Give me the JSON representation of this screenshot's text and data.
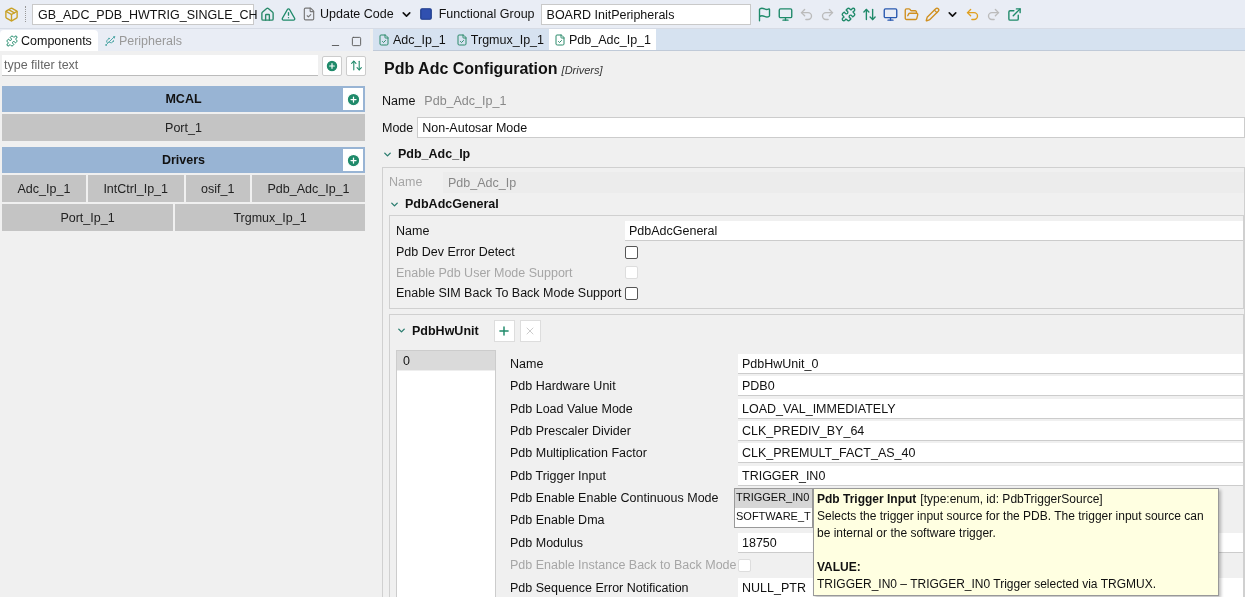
{
  "toolbar": {
    "project": "GB_ADC_PDB_HWTRIG_SINGLE_CH",
    "update_code": "Update Code",
    "functional_group_label": "Functional Group",
    "functional_group": "BOARD InitPeripherals"
  },
  "left_panel": {
    "tabs": [
      {
        "label": "Components",
        "selected": true
      },
      {
        "label": "Peripherals",
        "selected": false
      }
    ],
    "filter": {
      "placeholder": "type filter text"
    },
    "groups": [
      {
        "title": "MCAL",
        "rows": [
          [
            "Port_1"
          ]
        ]
      },
      {
        "title": "Drivers",
        "rows": [
          [
            "Adc_Ip_1",
            "IntCtrl_Ip_1",
            "osif_1",
            "Pdb_Adc_Ip_1"
          ],
          [
            "Port_Ip_1",
            "Trgmux_Ip_1"
          ]
        ]
      }
    ]
  },
  "editor_tabs": [
    {
      "label": "Adc_Ip_1",
      "selected": false
    },
    {
      "label": "Trgmux_Ip_1",
      "selected": false
    },
    {
      "label": "Pdb_Adc_Ip_1",
      "selected": true
    }
  ],
  "config": {
    "title": "Pdb Adc Configuration",
    "subtitle": "[Drivers]",
    "name": {
      "label": "Name",
      "value": "Pdb_Adc_Ip_1"
    },
    "mode": {
      "label": "Mode",
      "value": "Non-Autosar Mode"
    },
    "section": {
      "title": "Pdb_Adc_Ip",
      "expanded": true,
      "name_label": "Name",
      "name_value": "Pdb_Adc_Ip",
      "general": {
        "title": "PdbAdcGeneral",
        "expanded": true,
        "rows": [
          {
            "kind": "text",
            "label": "Name",
            "value": "PdbAdcGeneral",
            "disabled": false
          },
          {
            "kind": "checkbox",
            "label": "Pdb Dev Error Detect",
            "checked": false,
            "disabled": false
          },
          {
            "kind": "checkbox",
            "label": "Enable Pdb User Mode Support",
            "checked": false,
            "disabled": true
          },
          {
            "kind": "checkbox",
            "label": "Enable SIM Back To Back Mode Support",
            "checked": false,
            "disabled": false
          }
        ]
      },
      "hw_unit": {
        "title": "PdbHwUnit",
        "expanded": true,
        "list": [
          {
            "label": "0",
            "selected": true
          }
        ],
        "rows": [
          {
            "kind": "text",
            "label": "Name",
            "value": "PdbHwUnit_0",
            "disabled": false
          },
          {
            "kind": "text",
            "label": "Pdb Hardware Unit",
            "value": "PDB0",
            "disabled": false
          },
          {
            "kind": "text",
            "label": "Pdb Load Value Mode",
            "value": "LOAD_VAL_IMMEDIATELY",
            "disabled": false
          },
          {
            "kind": "text",
            "label": "Pdb Prescaler Divider",
            "value": "CLK_PREDIV_BY_64",
            "disabled": false
          },
          {
            "kind": "text",
            "label": "Pdb Multiplication Factor",
            "value": "CLK_PREMULT_FACT_AS_40",
            "disabled": false
          },
          {
            "kind": "text",
            "label": "Pdb Trigger Input",
            "value": "TRIGGER_IN0",
            "disabled": false
          },
          {
            "kind": "label",
            "label": "Pdb Enable Enable Continuous Mode",
            "disabled": false
          },
          {
            "kind": "label",
            "label": "Pdb Enable Dma",
            "disabled": false
          },
          {
            "kind": "text",
            "label": "Pdb Modulus",
            "value": "18750",
            "disabled": false
          },
          {
            "kind": "checkbox",
            "label": "Pdb Enable Instance Back to Back Mode",
            "checked": false,
            "disabled": true
          },
          {
            "kind": "text",
            "label": "Pdb Sequence Error Notification",
            "value": "NULL_PTR",
            "disabled": false
          }
        ]
      }
    }
  },
  "dropdown": {
    "options": [
      {
        "label": "TRIGGER_IN0",
        "selected": true
      },
      {
        "label": "SOFTWARE_T",
        "selected": false
      }
    ]
  },
  "tooltip": {
    "title": "Pdb Trigger Input",
    "meta": "[type:enum, id: PdbTriggerSource]",
    "description": "Selects the trigger input source for the PDB. The trigger input source can be internal or the software trigger.",
    "value_heading": "VALUE:",
    "value_text": "TRIGGER_IN0 – TRIGGER_IN0  Trigger selected via TRGMUX."
  }
}
